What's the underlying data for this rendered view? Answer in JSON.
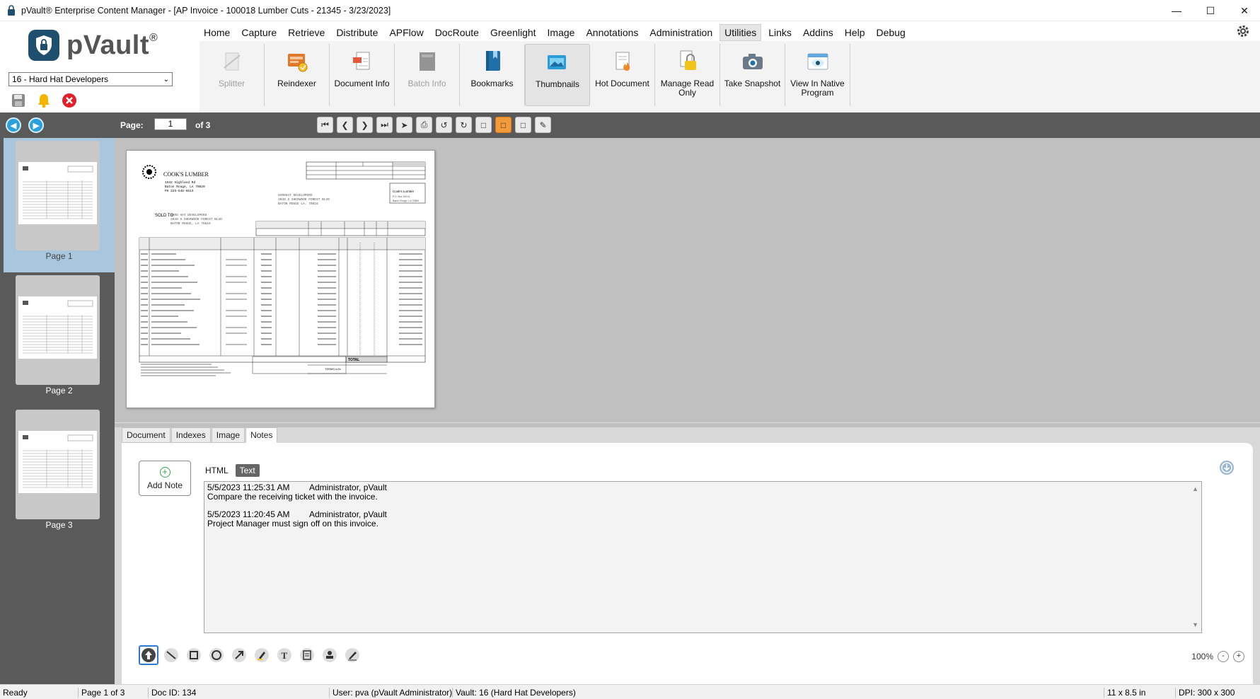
{
  "window": {
    "title": "pVault® Enterprise Content Manager - [AP Invoice - 100018 Lumber Cuts - 21345 - 3/23/2023]",
    "controls": [
      "minimize",
      "maximize",
      "close"
    ]
  },
  "logo": {
    "text": "pVault",
    "mark": "®"
  },
  "vault_select": {
    "value": "16 - Hard Hat Developers"
  },
  "menu": [
    "Home",
    "Capture",
    "Retrieve",
    "Distribute",
    "APFlow",
    "DocRoute",
    "Greenlight",
    "Image",
    "Annotations",
    "Administration",
    "Utilities",
    "Links",
    "Addins",
    "Help",
    "Debug"
  ],
  "menu_active": "Utilities",
  "ribbon": [
    {
      "label": "Splitter",
      "icon": "splitter-icon",
      "state": "disabled"
    },
    {
      "label": "Reindexer",
      "icon": "reindexer-icon",
      "state": "normal"
    },
    {
      "label": "Document Info",
      "icon": "document-info-icon",
      "state": "normal"
    },
    {
      "label": "Batch Info",
      "icon": "batch-info-icon",
      "state": "disabled"
    },
    {
      "label": "Bookmarks",
      "icon": "bookmarks-icon",
      "state": "normal"
    },
    {
      "label": "Thumbnails",
      "icon": "thumbnails-icon",
      "state": "selected"
    },
    {
      "label": "Hot Document",
      "icon": "hot-document-icon",
      "state": "normal"
    },
    {
      "label": "Manage Read Only",
      "icon": "manage-read-only-icon",
      "state": "normal"
    },
    {
      "label": "Take Snapshot",
      "icon": "camera-icon",
      "state": "normal"
    },
    {
      "label": "View In Native Program",
      "icon": "view-native-icon",
      "state": "normal"
    }
  ],
  "viewer": {
    "page_label": "Page:",
    "page_value": "1",
    "page_of": "of 3",
    "nav_tools": [
      "first-page-icon",
      "prev-page-icon",
      "next-page-icon",
      "last-page-icon",
      "send-icon",
      "print-icon",
      "rotate-left-icon",
      "rotate-right-icon",
      "page-icon",
      "page-orange-icon",
      "page-add-icon",
      "page-edit-icon"
    ]
  },
  "thumbnails": [
    {
      "label": "Page 1",
      "selected": true
    },
    {
      "label": "Page 2",
      "selected": false
    },
    {
      "label": "Page 3",
      "selected": false
    }
  ],
  "invoice": {
    "company": "COOK'S LUMBER",
    "address1": "1542 Highland Rd",
    "address2": "Baton Rouge, LA 70820",
    "phone": "PH 225-545-6513",
    "sold_to_label": "SOLD TO",
    "sold_to1": "HARD HAT DEVELOPERS",
    "sold_to2": "3049 S SHERWOOD FOREST BLVD",
    "sold_to3": "BATON ROUGE, LA 70816",
    "remit_to_label": "REMIT TO",
    "remit_to1": "Cook's Lumber",
    "remit_to2": "P.O. Box 34414",
    "remit_to3": "Baton Rouge, LA 70884",
    "total_label": "TOTAL",
    "terms_label": "TERMS n/2x"
  },
  "panel_tabs": [
    "Document",
    "Indexes",
    "Image",
    "Notes"
  ],
  "panel_active_tab": "Notes",
  "notes": {
    "add_label": "Add Note",
    "formats": [
      "HTML",
      "Text"
    ],
    "format_active": "Text",
    "entries": [
      {
        "timestamp": "5/5/2023 11:25:31 AM",
        "author": "Administrator, pVault",
        "text": "Compare the receiving ticket with the invoice."
      },
      {
        "timestamp": "5/5/2023 11:20:45 AM",
        "author": "Administrator, pVault",
        "text": "Project Manager must sign off on this invoice."
      }
    ]
  },
  "annotation_tools": [
    "pointer-icon",
    "line-icon",
    "rectangle-icon",
    "ellipse-icon",
    "arrow-icon",
    "highlighter-icon",
    "text-icon",
    "note-icon",
    "stamp-icon",
    "signature-icon"
  ],
  "zoom": {
    "value": "100%",
    "minus": "-",
    "plus": "+"
  },
  "status": {
    "ready": "Ready",
    "page": "Page 1 of 3",
    "doc_id": "Doc ID: 134",
    "user": "User: pva (pVault Administrator)",
    "vault": "Vault: 16 (Hard Hat Developers)",
    "size": "11 x 8.5 in",
    "dpi": "DPI: 300 x 300"
  },
  "colors": {
    "brand": "#1f4f6e",
    "accent": "#2aa0dc",
    "toolbar_dark": "#5a5a5a",
    "selected_thumb": "#a9c6df",
    "orange": "#f39a3b"
  }
}
